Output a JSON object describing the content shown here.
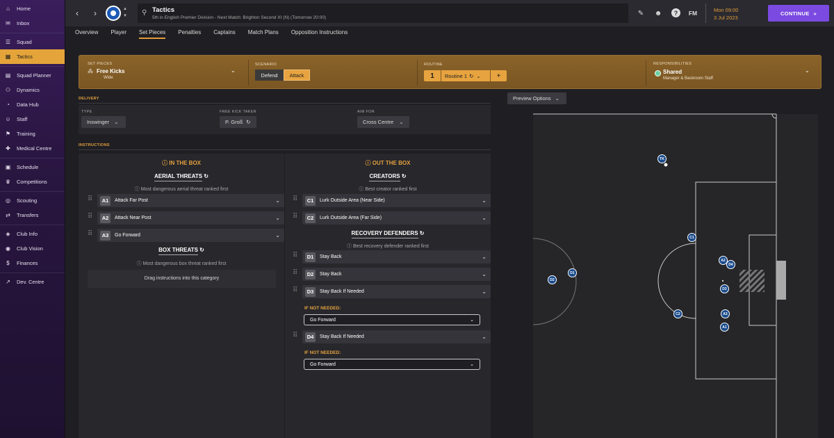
{
  "sidebar": {
    "items": [
      {
        "label": "Home",
        "icon": "home-icon",
        "selected": false
      },
      {
        "label": "Inbox",
        "icon": "inbox-icon",
        "selected": false
      },
      {
        "label": "Squad",
        "icon": "squad-icon",
        "selected": false
      },
      {
        "label": "Tactics",
        "icon": "tactics-icon",
        "selected": true
      },
      {
        "label": "Squad Planner",
        "icon": "squad-planner-icon",
        "selected": false
      },
      {
        "label": "Dynamics",
        "icon": "dynamics-icon",
        "selected": false
      },
      {
        "label": "Data Hub",
        "icon": "data-hub-icon",
        "selected": false
      },
      {
        "label": "Staff",
        "icon": "staff-icon",
        "selected": false
      },
      {
        "label": "Training",
        "icon": "training-icon",
        "selected": false
      },
      {
        "label": "Medical Centre",
        "icon": "medical-icon",
        "selected": false
      },
      {
        "label": "Schedule",
        "icon": "schedule-icon",
        "selected": false
      },
      {
        "label": "Competitions",
        "icon": "trophy-icon",
        "selected": false
      },
      {
        "label": "Scouting",
        "icon": "scouting-icon",
        "selected": false
      },
      {
        "label": "Transfers",
        "icon": "transfers-icon",
        "selected": false
      },
      {
        "label": "Club Info",
        "icon": "club-info-icon",
        "selected": false
      },
      {
        "label": "Club Vision",
        "icon": "club-vision-icon",
        "selected": false
      },
      {
        "label": "Finances",
        "icon": "finances-icon",
        "selected": false
      },
      {
        "label": "Dev. Centre",
        "icon": "dev-centre-icon",
        "selected": false
      }
    ]
  },
  "header": {
    "title": "Tactics",
    "subtitle": "5th in English Premier Division - Next Match: Brighton Second XI (N) (Tomorrow 20:00)",
    "date_line1": "Mon 09:00",
    "date_line2": "3 Jul 2023",
    "fm_label": "FM",
    "help_label": "?",
    "continue_label": "CONTINUE",
    "continue_color": "#7b4ae0"
  },
  "tabs": [
    {
      "label": "Overview",
      "active": false
    },
    {
      "label": "Player",
      "active": false
    },
    {
      "label": "Set Pieces",
      "active": true
    },
    {
      "label": "Penalties",
      "active": false
    },
    {
      "label": "Captains",
      "active": false
    },
    {
      "label": "Match Plans",
      "active": false
    },
    {
      "label": "Opposition Instructions",
      "active": false
    }
  ],
  "setpieces": {
    "label": "SET PIECES",
    "value": "Free Kicks",
    "sub": "Wide",
    "scenario_label": "SCENARIO",
    "scenario_defend": "Defend",
    "scenario_attack": "Attack",
    "routine_label": "ROUTINE",
    "routine_number": "1",
    "routine_name": "Routine 1",
    "routine_add": "+",
    "resp_label": "RESPONSIBILITIES",
    "resp_value": "Shared",
    "resp_sub": "Manager & Backroom Staff",
    "accent_color": "#e7a33f"
  },
  "delivery": {
    "section_label": "DELIVERY",
    "type_label": "TYPE",
    "type_value": "Inswinger",
    "taker_label": "FREE KICK TAKER",
    "taker_value": "P. Groß",
    "aim_label": "AIM FOR",
    "aim_value": "Cross Centre"
  },
  "instructions": {
    "section_label": "INSTRUCTIONS",
    "in_box": {
      "heading": "IN THE BOX",
      "aerial_title": "AERIAL THREATS",
      "aerial_sub": "Most dangerous aerial threat ranked first",
      "aerial": [
        {
          "badge": "A1",
          "text": "Attack Far Post"
        },
        {
          "badge": "A2",
          "text": "Attack Near Post"
        },
        {
          "badge": "A3",
          "text": "Go Forward"
        }
      ],
      "box_title": "BOX THREATS",
      "box_sub": "Most dangerous box threat ranked first",
      "box_drop": "Drag instructions into this category"
    },
    "out_box": {
      "heading": "OUT THE BOX",
      "creators_title": "CREATORS",
      "creators_sub": "Best creator ranked first",
      "creators": [
        {
          "badge": "C1",
          "text": "Lurk Outside Area (Near Side)"
        },
        {
          "badge": "C2",
          "text": "Lurk Outside Area (Far Side)"
        }
      ],
      "recovery_title": "RECOVERY DEFENDERS",
      "recovery_sub": "Best recovery defender ranked first",
      "recovery": [
        {
          "badge": "D1",
          "text": "Stay Back"
        },
        {
          "badge": "D2",
          "text": "Stay Back"
        },
        {
          "badge": "D3",
          "text": "Stay Back If Needed"
        },
        {
          "badge": "D4",
          "text": "Stay Back If Needed"
        }
      ],
      "if_not_needed_label": "IF NOT NEEDED:",
      "if_not_needed_d3": "Go Forward",
      "if_not_needed_d4": "Go Forward"
    }
  },
  "preview": {
    "label": "Preview Options",
    "players": [
      "TK",
      "C1",
      "A2",
      "D4",
      "D3",
      "A3",
      "A1",
      "C2",
      "D1",
      "D2"
    ]
  }
}
